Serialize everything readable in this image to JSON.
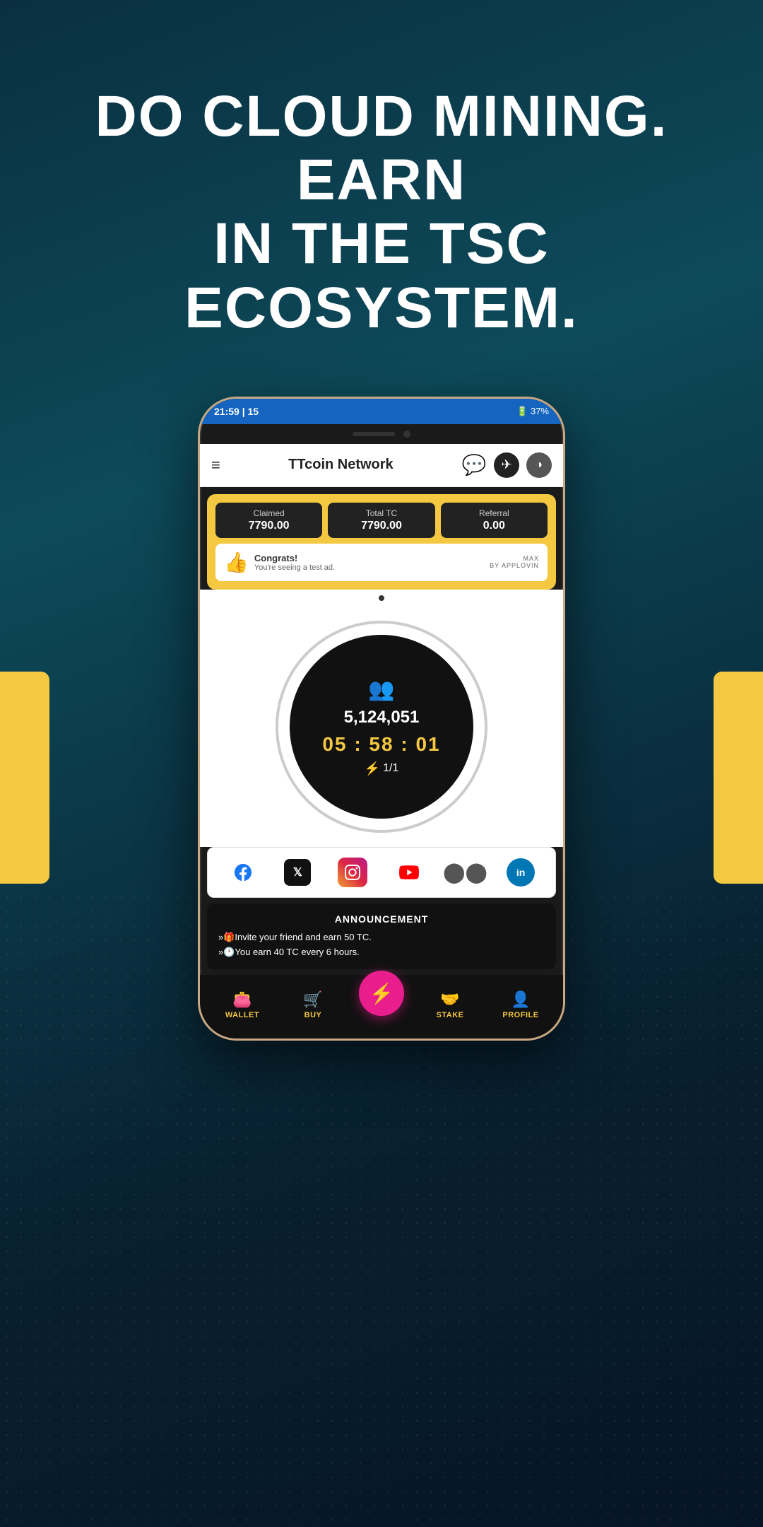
{
  "headline": {
    "line1": "DO CLOUD MINING. EARN",
    "line2": "IN THE TSC ECOSYSTEM."
  },
  "statusBar": {
    "time": "21:59 | 15",
    "battery": "37%"
  },
  "header": {
    "title": "TTcoin Network",
    "menuIcon": "≡",
    "whatsappIcon": "💬",
    "telegramIcon": "✈",
    "logoIcon": "◑"
  },
  "stats": {
    "claimed": {
      "label": "Claimed",
      "value": "7790.00"
    },
    "totalTC": {
      "label": "Total TC",
      "value": "7790.00"
    },
    "referral": {
      "label": "Referral",
      "value": "0.00"
    }
  },
  "adBanner": {
    "emoji": "👍",
    "title": "Congrats!",
    "subtitle": "You're seeing a test ad.",
    "brand": "MAX",
    "brandSub": "BY APPLOVIN"
  },
  "mining": {
    "usersIcon": "👥",
    "count": "5,124,051",
    "timer": "05 : 58 : 01",
    "boostLabel": "1/1"
  },
  "social": {
    "facebook": "f",
    "twitter": "𝕏",
    "instagram": "📷",
    "youtube": "▶",
    "medium": "◉",
    "linkedin": "in"
  },
  "announcement": {
    "title": "ANNOUNCEMENT",
    "items": [
      "»🎁Invite your friend and earn 50 TC.",
      "»🕐You earn 40 TC every 6 hours."
    ]
  },
  "bottomNav": {
    "wallet": "WALLET",
    "buy": "BUY",
    "stake": "STAKE",
    "profile": "PROFILE",
    "centerBolt": "⚡"
  }
}
